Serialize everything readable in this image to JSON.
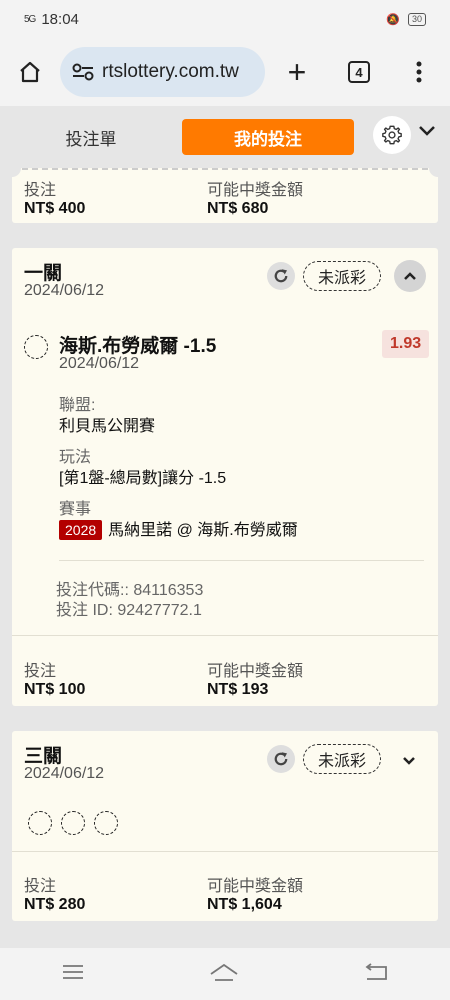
{
  "status_bar": {
    "time": "18:04",
    "signal": "5G",
    "battery": "30"
  },
  "browser": {
    "url": "rtslottery.com.tw",
    "tab_count": "4",
    "icons": [
      "home-icon",
      "tune-icon",
      "plus-icon",
      "tabs-icon",
      "more-vert-icon"
    ]
  },
  "tabs": {
    "bet_slip": "投注單",
    "my_bets": "我的投注"
  },
  "accent_color": "#ff7a00",
  "top_card": {
    "stake_label": "投注",
    "stake_value": "NT$ 400",
    "payout_label": "可能中獎金額",
    "payout_value": "NT$ 680"
  },
  "card1": {
    "title": "一關",
    "date": "2024/06/12",
    "status": "未派彩",
    "pick": {
      "name": "海斯.布勞威爾 -1.5",
      "date": "2024/06/12",
      "odds": "1.93",
      "league_label": "聯盟:",
      "league_value": "利貝馬公開賽",
      "market_label": "玩法",
      "market_value": "[第1盤-總局數]讓分 -1.5",
      "event_label": "賽事",
      "event_code": "2028",
      "event_name": "馬納里諾 @ 海斯.布勞威爾"
    },
    "bet_code": "投注代碼:: 84116353",
    "bet_id": "投注 ID: 92427772.1",
    "stake_label": "投注",
    "stake_value": "NT$ 100",
    "payout_label": "可能中獎金額",
    "payout_value": "NT$ 193"
  },
  "card3": {
    "title": "三關",
    "date": "2024/06/12",
    "status": "未派彩",
    "stake_label": "投注",
    "stake_value": "NT$ 280",
    "payout_label": "可能中獎金額",
    "payout_value": "NT$ 1,604"
  }
}
